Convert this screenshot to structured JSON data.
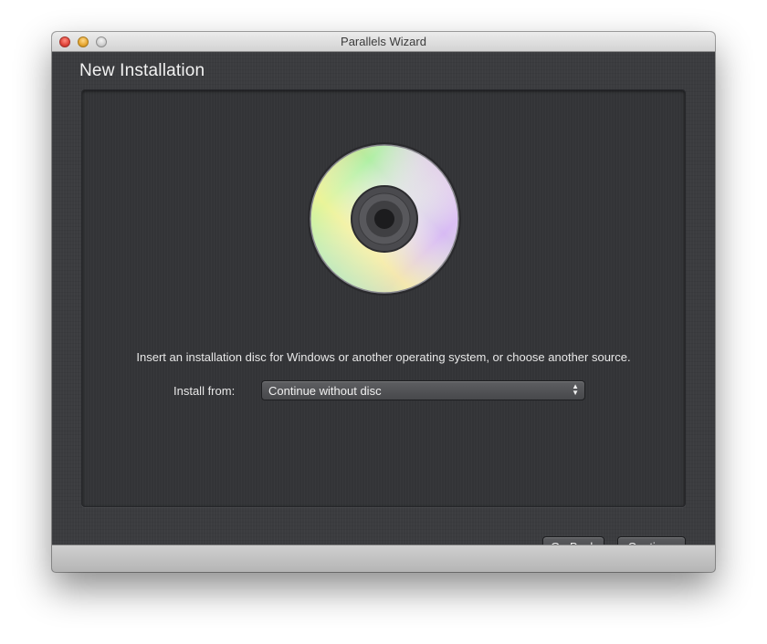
{
  "window": {
    "title": "Parallels Wizard"
  },
  "page": {
    "title": "New Installation",
    "instruction": "Insert an installation disc for Windows or another operating system, or choose another source."
  },
  "install_from": {
    "label": "Install from:",
    "selected": "Continue without disc"
  },
  "buttons": {
    "help": "?",
    "go_back": "Go Back",
    "continue": "Continue"
  },
  "icons": {
    "disc": "dvd-disc-icon",
    "help": "question-mark-icon",
    "select_arrows": "up-down-arrows-icon"
  },
  "colors": {
    "background": "#3b3c3f",
    "panel": "#333437",
    "help_button": "#6a3aa3",
    "close_button": "#e0443a",
    "minimize_button": "#e6a630"
  }
}
